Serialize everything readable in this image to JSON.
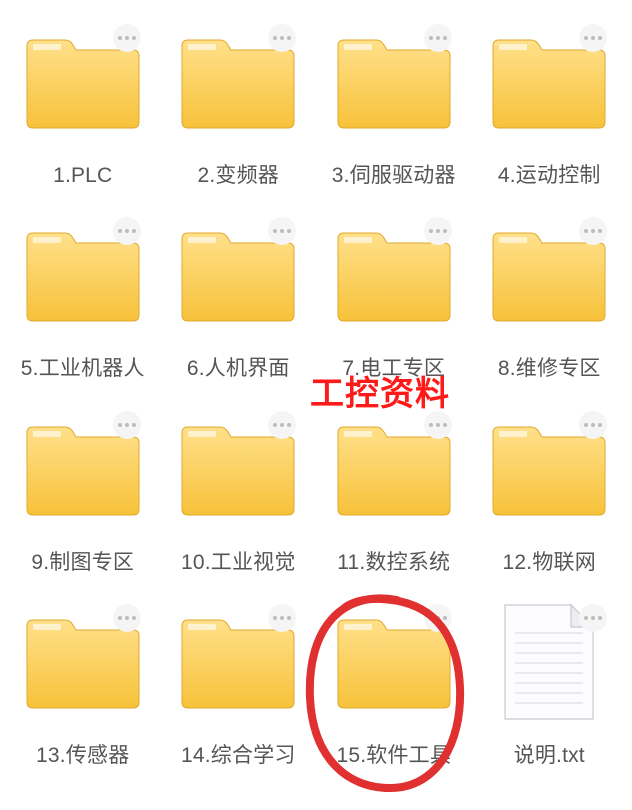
{
  "overlay_text": "工控资料",
  "items": [
    {
      "kind": "folder",
      "label": "1.PLC"
    },
    {
      "kind": "folder",
      "label": "2.变频器"
    },
    {
      "kind": "folder",
      "label": "3.伺服驱动器"
    },
    {
      "kind": "folder",
      "label": "4.运动控制"
    },
    {
      "kind": "folder",
      "label": "5.工业机器人"
    },
    {
      "kind": "folder",
      "label": "6.人机界面"
    },
    {
      "kind": "folder",
      "label": "7.电工专区"
    },
    {
      "kind": "folder",
      "label": "8.维修专区"
    },
    {
      "kind": "folder",
      "label": "9.制图专区"
    },
    {
      "kind": "folder",
      "label": "10.工业视觉"
    },
    {
      "kind": "folder",
      "label": "11.数控系统"
    },
    {
      "kind": "folder",
      "label": "12.物联网"
    },
    {
      "kind": "folder",
      "label": "13.传感器"
    },
    {
      "kind": "folder",
      "label": "14.综合学习"
    },
    {
      "kind": "folder",
      "label": "15.软件工具",
      "circled": true
    },
    {
      "kind": "txt",
      "label": "说明.txt"
    }
  ]
}
